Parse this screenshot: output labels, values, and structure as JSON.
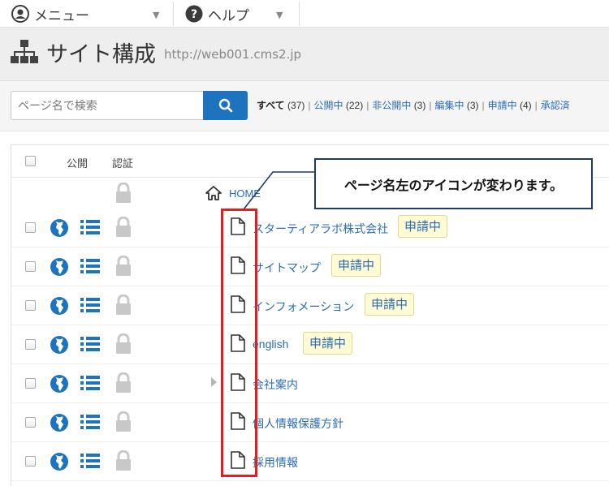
{
  "topbar": {
    "menu_label": "メニュー",
    "help_label": "ヘルプ"
  },
  "header": {
    "title": "サイト構成",
    "url": "http://web001.cms2.jp"
  },
  "search": {
    "placeholder": "ページ名で検索"
  },
  "filters": {
    "all": {
      "label": "すべて",
      "count": "(37)"
    },
    "items": [
      {
        "label": "公開中",
        "count": "(22)"
      },
      {
        "label": "非公開中",
        "count": "(3)"
      },
      {
        "label": "編集中",
        "count": "(3)"
      },
      {
        "label": "申請中",
        "count": "(4)"
      },
      {
        "label": "承認済",
        "count": ""
      }
    ]
  },
  "table": {
    "col_public": "公開",
    "col_auth": "認証",
    "home_label": "HOME",
    "rows": [
      {
        "name": "スターティアラボ株式会社",
        "badge": "申請中"
      },
      {
        "name": "サイトマップ",
        "badge": "申請中"
      },
      {
        "name": "インフォメーション",
        "badge": "申請中"
      },
      {
        "name": "english",
        "badge": "申請中"
      },
      {
        "name": "会社案内",
        "badge": ""
      },
      {
        "name": "個人情報保護方針",
        "badge": ""
      },
      {
        "name": "採用情報",
        "badge": ""
      }
    ]
  },
  "annotation": {
    "text": "ページ名左のアイコンが変わります。"
  },
  "colors": {
    "accent": "#1e73be",
    "link": "#2a6cb5",
    "badge_bg": "#fffbd5",
    "highlight": "#e02020",
    "callout_border": "#1f3a64"
  }
}
